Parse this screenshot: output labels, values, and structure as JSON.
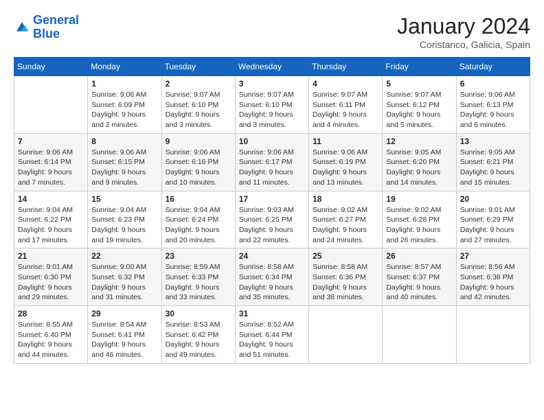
{
  "header": {
    "logo_line1": "General",
    "logo_line2": "Blue",
    "month_title": "January 2024",
    "location": "Coristanco, Galicia, Spain"
  },
  "weekdays": [
    "Sunday",
    "Monday",
    "Tuesday",
    "Wednesday",
    "Thursday",
    "Friday",
    "Saturday"
  ],
  "weeks": [
    [
      {
        "day": "",
        "sunrise": "",
        "sunset": "",
        "daylight": ""
      },
      {
        "day": "1",
        "sunrise": "Sunrise: 9:06 AM",
        "sunset": "Sunset: 6:09 PM",
        "daylight": "Daylight: 9 hours and 2 minutes."
      },
      {
        "day": "2",
        "sunrise": "Sunrise: 9:07 AM",
        "sunset": "Sunset: 6:10 PM",
        "daylight": "Daylight: 9 hours and 3 minutes."
      },
      {
        "day": "3",
        "sunrise": "Sunrise: 9:07 AM",
        "sunset": "Sunset: 6:10 PM",
        "daylight": "Daylight: 9 hours and 3 minutes."
      },
      {
        "day": "4",
        "sunrise": "Sunrise: 9:07 AM",
        "sunset": "Sunset: 6:11 PM",
        "daylight": "Daylight: 9 hours and 4 minutes."
      },
      {
        "day": "5",
        "sunrise": "Sunrise: 9:07 AM",
        "sunset": "Sunset: 6:12 PM",
        "daylight": "Daylight: 9 hours and 5 minutes."
      },
      {
        "day": "6",
        "sunrise": "Sunrise: 9:06 AM",
        "sunset": "Sunset: 6:13 PM",
        "daylight": "Daylight: 9 hours and 6 minutes."
      }
    ],
    [
      {
        "day": "7",
        "sunrise": "Sunrise: 9:06 AM",
        "sunset": "Sunset: 6:14 PM",
        "daylight": "Daylight: 9 hours and 7 minutes."
      },
      {
        "day": "8",
        "sunrise": "Sunrise: 9:06 AM",
        "sunset": "Sunset: 6:15 PM",
        "daylight": "Daylight: 9 hours and 9 minutes."
      },
      {
        "day": "9",
        "sunrise": "Sunrise: 9:06 AM",
        "sunset": "Sunset: 6:16 PM",
        "daylight": "Daylight: 9 hours and 10 minutes."
      },
      {
        "day": "10",
        "sunrise": "Sunrise: 9:06 AM",
        "sunset": "Sunset: 6:17 PM",
        "daylight": "Daylight: 9 hours and 11 minutes."
      },
      {
        "day": "11",
        "sunrise": "Sunrise: 9:06 AM",
        "sunset": "Sunset: 6:19 PM",
        "daylight": "Daylight: 9 hours and 13 minutes."
      },
      {
        "day": "12",
        "sunrise": "Sunrise: 9:05 AM",
        "sunset": "Sunset: 6:20 PM",
        "daylight": "Daylight: 9 hours and 14 minutes."
      },
      {
        "day": "13",
        "sunrise": "Sunrise: 9:05 AM",
        "sunset": "Sunset: 6:21 PM",
        "daylight": "Daylight: 9 hours and 15 minutes."
      }
    ],
    [
      {
        "day": "14",
        "sunrise": "Sunrise: 9:04 AM",
        "sunset": "Sunset: 6:22 PM",
        "daylight": "Daylight: 9 hours and 17 minutes."
      },
      {
        "day": "15",
        "sunrise": "Sunrise: 9:04 AM",
        "sunset": "Sunset: 6:23 PM",
        "daylight": "Daylight: 9 hours and 19 minutes."
      },
      {
        "day": "16",
        "sunrise": "Sunrise: 9:04 AM",
        "sunset": "Sunset: 6:24 PM",
        "daylight": "Daylight: 9 hours and 20 minutes."
      },
      {
        "day": "17",
        "sunrise": "Sunrise: 9:03 AM",
        "sunset": "Sunset: 6:25 PM",
        "daylight": "Daylight: 9 hours and 22 minutes."
      },
      {
        "day": "18",
        "sunrise": "Sunrise: 9:02 AM",
        "sunset": "Sunset: 6:27 PM",
        "daylight": "Daylight: 9 hours and 24 minutes."
      },
      {
        "day": "19",
        "sunrise": "Sunrise: 9:02 AM",
        "sunset": "Sunset: 6:28 PM",
        "daylight": "Daylight: 9 hours and 26 minutes."
      },
      {
        "day": "20",
        "sunrise": "Sunrise: 9:01 AM",
        "sunset": "Sunset: 6:29 PM",
        "daylight": "Daylight: 9 hours and 27 minutes."
      }
    ],
    [
      {
        "day": "21",
        "sunrise": "Sunrise: 9:01 AM",
        "sunset": "Sunset: 6:30 PM",
        "daylight": "Daylight: 9 hours and 29 minutes."
      },
      {
        "day": "22",
        "sunrise": "Sunrise: 9:00 AM",
        "sunset": "Sunset: 6:32 PM",
        "daylight": "Daylight: 9 hours and 31 minutes."
      },
      {
        "day": "23",
        "sunrise": "Sunrise: 8:59 AM",
        "sunset": "Sunset: 6:33 PM",
        "daylight": "Daylight: 9 hours and 33 minutes."
      },
      {
        "day": "24",
        "sunrise": "Sunrise: 8:58 AM",
        "sunset": "Sunset: 6:34 PM",
        "daylight": "Daylight: 9 hours and 35 minutes."
      },
      {
        "day": "25",
        "sunrise": "Sunrise: 8:58 AM",
        "sunset": "Sunset: 6:36 PM",
        "daylight": "Daylight: 9 hours and 38 minutes."
      },
      {
        "day": "26",
        "sunrise": "Sunrise: 8:57 AM",
        "sunset": "Sunset: 6:37 PM",
        "daylight": "Daylight: 9 hours and 40 minutes."
      },
      {
        "day": "27",
        "sunrise": "Sunrise: 8:56 AM",
        "sunset": "Sunset: 6:38 PM",
        "daylight": "Daylight: 9 hours and 42 minutes."
      }
    ],
    [
      {
        "day": "28",
        "sunrise": "Sunrise: 8:55 AM",
        "sunset": "Sunset: 6:40 PM",
        "daylight": "Daylight: 9 hours and 44 minutes."
      },
      {
        "day": "29",
        "sunrise": "Sunrise: 8:54 AM",
        "sunset": "Sunset: 6:41 PM",
        "daylight": "Daylight: 9 hours and 46 minutes."
      },
      {
        "day": "30",
        "sunrise": "Sunrise: 8:53 AM",
        "sunset": "Sunset: 6:42 PM",
        "daylight": "Daylight: 9 hours and 49 minutes."
      },
      {
        "day": "31",
        "sunrise": "Sunrise: 8:52 AM",
        "sunset": "Sunset: 6:44 PM",
        "daylight": "Daylight: 9 hours and 51 minutes."
      },
      {
        "day": "",
        "sunrise": "",
        "sunset": "",
        "daylight": ""
      },
      {
        "day": "",
        "sunrise": "",
        "sunset": "",
        "daylight": ""
      },
      {
        "day": "",
        "sunrise": "",
        "sunset": "",
        "daylight": ""
      }
    ]
  ]
}
